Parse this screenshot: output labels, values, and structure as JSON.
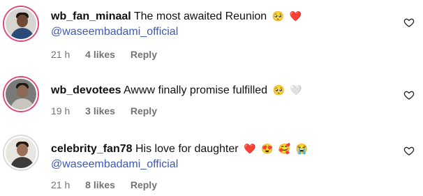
{
  "comments": [
    {
      "username": "wb_fan_minaal",
      "text": "The most awaited Reunion",
      "emojis": [
        "🥺",
        "❤️"
      ],
      "mention": "@waseembadami_official",
      "time": "21 h",
      "likes": "4 likes",
      "reply": "Reply"
    },
    {
      "username": "wb_devotees",
      "text": "Awww finally promise fulfilled",
      "emojis": [
        "🥺",
        "🤍"
      ],
      "mention": "",
      "time": "19 h",
      "likes": "3 likes",
      "reply": "Reply"
    },
    {
      "username": "celebrity_fan78",
      "text": "His love for daughter",
      "emojis": [
        "❤️",
        "😍",
        "🥰",
        "😭"
      ],
      "mention": "@waseembadami_official",
      "time": "21 h",
      "likes": "8 likes",
      "reply": "Reply"
    }
  ],
  "colors": {
    "mention": "#3b5ab9",
    "meta": "#737373",
    "story_ring": "#e0457b"
  }
}
